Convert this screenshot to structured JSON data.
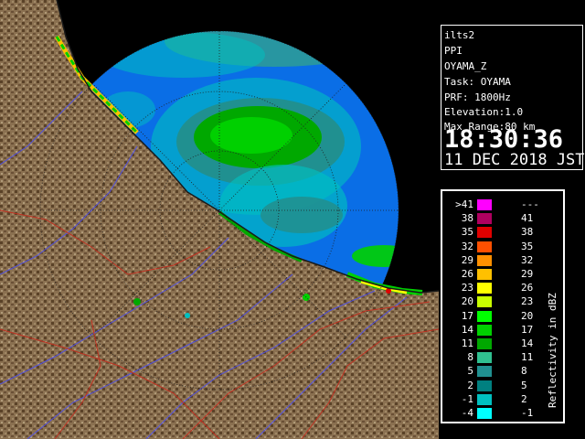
{
  "radar_info": {
    "station": "ilts2",
    "product": "PPI",
    "radar_name": "OYAMA_Z",
    "task": "Task: OYAMA",
    "prf": "PRF: 1800Hz",
    "elevation": "Elevation:1.0",
    "max_range": "Max Range:80 km",
    "time": "18:30:36",
    "date": "11 DEC 2018 JST"
  },
  "legend": {
    "title": "Reflectivity in dBZ",
    "bins": [
      {
        "low": ">41",
        "high": "---",
        "color": "#ff00ff"
      },
      {
        "low": "38",
        "high": "41",
        "color": "#b00060"
      },
      {
        "low": "35",
        "high": "38",
        "color": "#e00000"
      },
      {
        "low": "32",
        "high": "35",
        "color": "#ff5000"
      },
      {
        "low": "29",
        "high": "32",
        "color": "#ff9000"
      },
      {
        "low": "26",
        "high": "29",
        "color": "#ffc000"
      },
      {
        "low": "23",
        "high": "26",
        "color": "#ffff00"
      },
      {
        "low": "20",
        "high": "23",
        "color": "#c8ff00"
      },
      {
        "low": "17",
        "high": "20",
        "color": "#00ff00"
      },
      {
        "low": "14",
        "high": "17",
        "color": "#00d000"
      },
      {
        "low": "11",
        "high": "14",
        "color": "#00a800"
      },
      {
        "low": "8",
        "high": "11",
        "color": "#30c090"
      },
      {
        "low": "5",
        "high": "8",
        "color": "#209090"
      },
      {
        "low": "2",
        "high": "5",
        "color": "#008080"
      },
      {
        "low": "-1",
        "high": "2",
        "color": "#00c0c0"
      },
      {
        "low": "-4",
        "high": "-1",
        "color": "#00ffff"
      }
    ]
  },
  "colors": {
    "sea": "#0a6ee6",
    "land": "#8a7050",
    "land_dark": "#5a4228",
    "background": "#000000",
    "rivers": "#5050e0",
    "boundaries": "#c03020",
    "range_rings": "#202020"
  }
}
